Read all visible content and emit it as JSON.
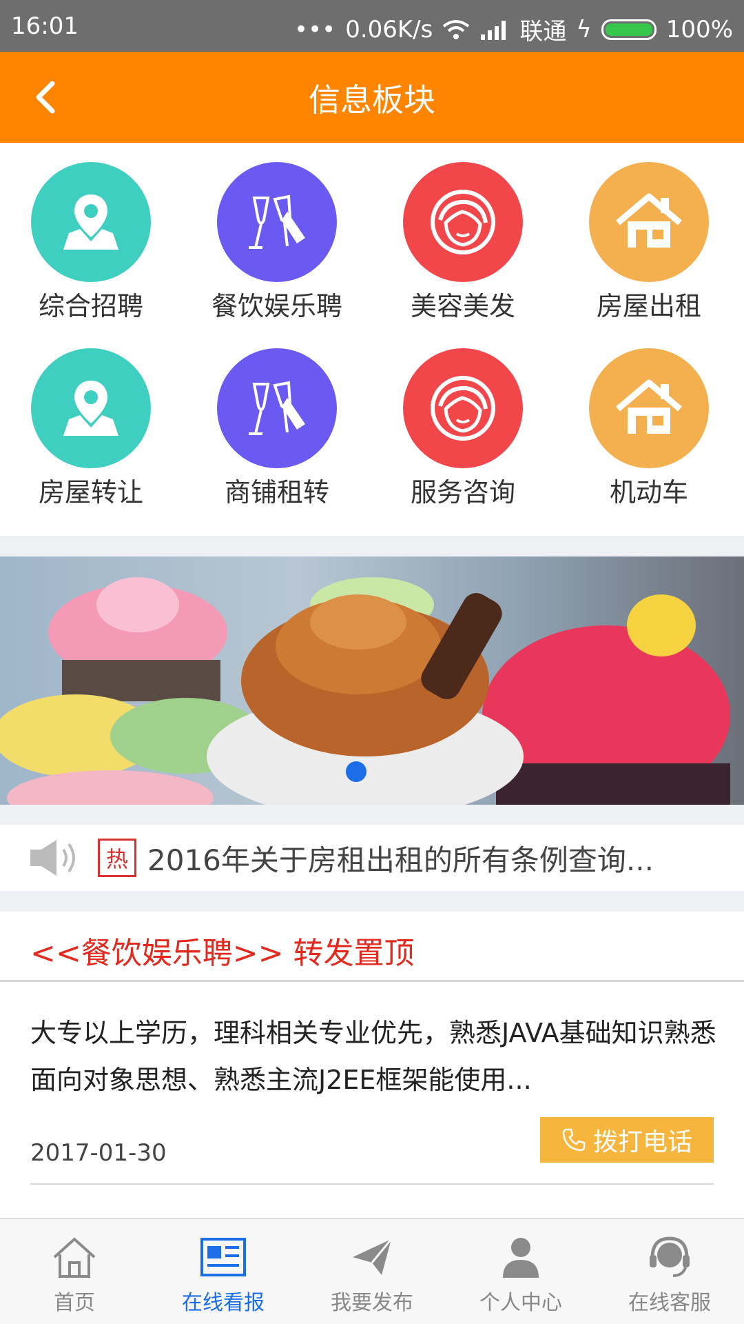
{
  "status": {
    "time": "16:01",
    "speed": "0.06K/s",
    "carrier": "联通",
    "battery": "100%"
  },
  "header": {
    "title": "信息板块"
  },
  "categories": [
    {
      "label": "综合招聘",
      "color": "#3ecfc0",
      "icon": "map-pin-icon"
    },
    {
      "label": "餐饮娱乐聘",
      "color": "#6a5af2",
      "icon": "champagne-icon"
    },
    {
      "label": "美容美发",
      "color": "#f2474a",
      "icon": "woman-face-icon"
    },
    {
      "label": "房屋出租",
      "color": "#f4b04f",
      "icon": "house-icon"
    },
    {
      "label": "房屋转让",
      "color": "#3ecfc0",
      "icon": "map-pin-icon"
    },
    {
      "label": "商铺租转",
      "color": "#6a5af2",
      "icon": "champagne-icon"
    },
    {
      "label": "服务咨询",
      "color": "#f2474a",
      "icon": "woman-face-icon"
    },
    {
      "label": "机动车",
      "color": "#f4b04f",
      "icon": "house-icon"
    }
  ],
  "notice": {
    "hot_label": "热",
    "text": "2016年关于房租出租的所有条例查询..."
  },
  "section": {
    "title": "<<餐饮娱乐聘>> 转发置顶"
  },
  "post": {
    "body": "大专以上学历，理科相关专业优先，熟悉JAVA基础知识熟悉面向对象思想、熟悉主流J2EE框架能使用...",
    "date": "2017-01-30",
    "call_label": "拨打电话"
  },
  "tabs": [
    {
      "label": "首页",
      "icon": "home-icon",
      "active": false
    },
    {
      "label": "在线看报",
      "icon": "newspaper-icon",
      "active": true
    },
    {
      "label": "我要发布",
      "icon": "send-icon",
      "active": false
    },
    {
      "label": "个人中心",
      "icon": "person-icon",
      "active": false
    },
    {
      "label": "在线客服",
      "icon": "headset-icon",
      "active": false
    }
  ],
  "colors": {
    "header": "#ff8400",
    "accent": "#1c6ee8",
    "hot": "#d93030",
    "section_title": "#e22a1e",
    "call_button": "#f6b63e"
  }
}
